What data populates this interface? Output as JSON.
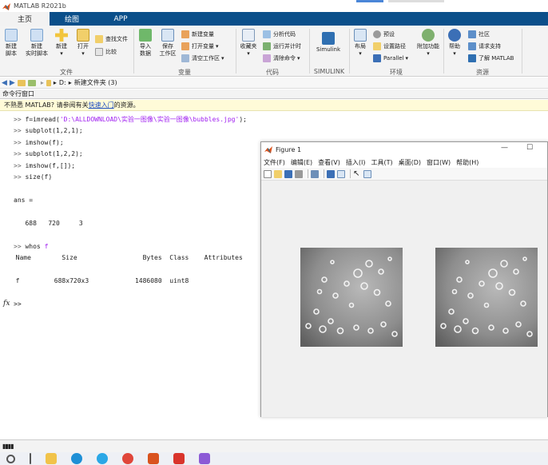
{
  "app": {
    "title": "MATLAB R2021b"
  },
  "tabs": [
    "主页",
    "绘图",
    "APP"
  ],
  "ribbon": {
    "file": {
      "label": "文件",
      "new_script": "新建\n脚本",
      "new_live_script": "新建\n实时脚本",
      "new": "新建",
      "open": "打开",
      "find_files": "查找文件",
      "compare": "比较"
    },
    "variable": {
      "label": "变量",
      "import_data": "导入\n数据",
      "save_workspace": "保存\n工作区",
      "new_variable": "新建变量",
      "open_variable": "打开变量",
      "clear_workspace": "清空工作区"
    },
    "code": {
      "label": "代码",
      "favorites": "收藏夹",
      "analyze_code": "分析代码",
      "run_and_time": "运行并计时",
      "clear_commands": "清除命令"
    },
    "simulink": {
      "label": "SIMULINK",
      "simulink": "Simulink"
    },
    "environment": {
      "label": "环境",
      "layout": "布局",
      "preferences": "预设",
      "set_path": "设置路径",
      "parallel": "Parallel",
      "addons": "附加功能"
    },
    "resources": {
      "label": "资源",
      "help": "帮助",
      "community": "社区",
      "request_support": "请求支持",
      "learn_matlab": "了解 MATLAB"
    }
  },
  "address": {
    "drive": "D:",
    "folder": "新建文件夹 (3)"
  },
  "panel": {
    "title": "命令行窗口"
  },
  "banner": {
    "prefix": "不熟悉 MATLAB? 请参阅有关",
    "link": "快速入门",
    "suffix": "的资源。"
  },
  "commands": {
    "c1_pre": "f=imread(",
    "c1_str": "'D:\\ALLDOWNLOAD\\实验一图像\\实验一图像\\bubbles.jpg'",
    "c1_post": ");",
    "c2": "subplot(1,2,1);",
    "c3": "imshow(f);",
    "c4": "subplot(1,2,2);",
    "c5": "imshow(f,[]);",
    "c6": "size(f)",
    "ans_label": "ans =",
    "ans_values": "   688   720     3",
    "whos_pre": "whos ",
    "whos_arg": "f",
    "whos_header": "  Name        Size                 Bytes  Class    Attributes",
    "whos_row": "  f         688x720x3            1486080  uint8",
    "prompt": ">>",
    "fx": "fx"
  },
  "figure": {
    "title": "Figure 1",
    "menu": [
      "文件(F)",
      "编辑(E)",
      "查看(V)",
      "插入(I)",
      "工具(T)",
      "桌面(D)",
      "窗口(W)",
      "帮助(H)"
    ]
  },
  "colors": {
    "tabbar": "#0b4f8a",
    "banner_bg": "#fffbd8",
    "string": "#a020f0"
  }
}
